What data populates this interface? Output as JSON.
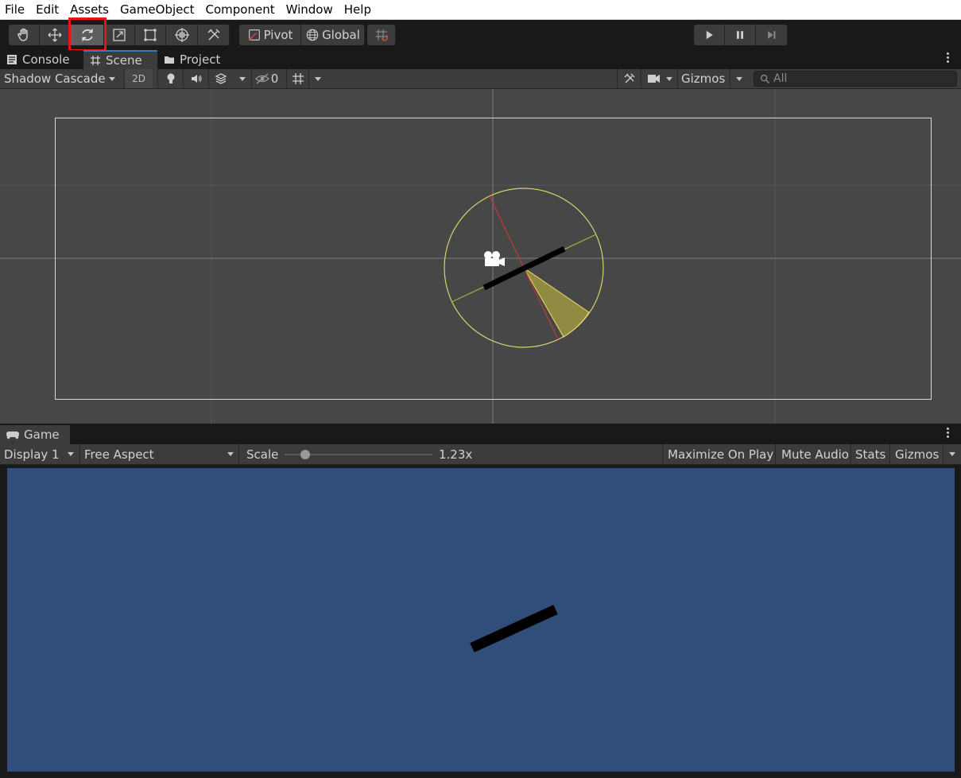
{
  "menu": [
    "File",
    "Edit",
    "Assets",
    "GameObject",
    "Component",
    "Window",
    "Help"
  ],
  "toolbar": {
    "tools": [
      {
        "name": "hand-tool",
        "icon": "hand-icon"
      },
      {
        "name": "move-tool",
        "icon": "move-icon"
      },
      {
        "name": "rotate-tool",
        "icon": "rotate-icon",
        "active": true
      },
      {
        "name": "scale-tool",
        "icon": "scale-icon"
      },
      {
        "name": "rect-tool",
        "icon": "rect-icon"
      },
      {
        "name": "transform-tool",
        "icon": "transform-icon"
      },
      {
        "name": "custom-tool",
        "icon": "tools-icon"
      }
    ],
    "pivot_label": "Pivot",
    "global_label": "Global",
    "play": [
      "play-icon",
      "pause-icon",
      "step-icon"
    ]
  },
  "top_tabs": [
    {
      "label": "Console",
      "icon": "console-icon"
    },
    {
      "label": "Scene",
      "icon": "scene-grid-icon",
      "active": true
    },
    {
      "label": "Project",
      "icon": "folder-icon"
    }
  ],
  "scene_toolbar": {
    "draw_mode": "Shadow Cascade",
    "mode_2d": "2D",
    "hidden_count": "0",
    "gizmos": "Gizmos",
    "search_placeholder": "All"
  },
  "game_tab": {
    "label": "Game",
    "icon": "gamepad-icon"
  },
  "game_toolbar": {
    "display": "Display 1",
    "aspect": "Free Aspect",
    "scale_label": "Scale",
    "scale_value": "1.23x",
    "scale_fraction": 0.14,
    "maximize": "Maximize On Play",
    "mute": "Mute Audio",
    "stats": "Stats",
    "gizmos": "Gizmos"
  },
  "colors": {
    "scene_bg": "#474747",
    "game_bg": "#314d79",
    "accent_tab": "#3a79bb",
    "highlight": "#e51515",
    "gizmo_yellow": "#d6d36a"
  }
}
